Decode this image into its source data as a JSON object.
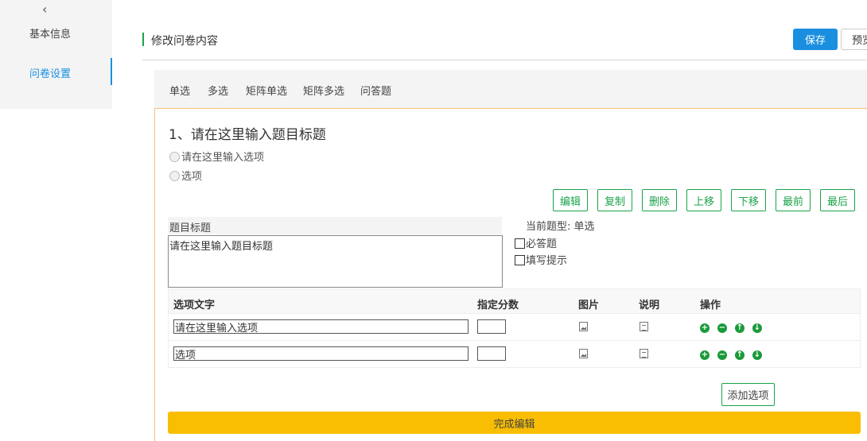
{
  "sidebar": {
    "back_icon": "chevron-left-icon",
    "items": [
      {
        "label": "基本信息"
      },
      {
        "label": "问卷设置"
      }
    ]
  },
  "header": {
    "title": "修改问卷内容",
    "save_label": "保存",
    "preview_label": "预览"
  },
  "question_types": [
    "单选",
    "多选",
    "矩阵单选",
    "矩阵多选",
    "问答题"
  ],
  "question": {
    "title": "1、请在这里输入题目标题",
    "options": [
      "请在这里输入选项",
      "选项"
    ],
    "actions": [
      "编辑",
      "复制",
      "删除",
      "上移",
      "下移",
      "最前",
      "最后"
    ],
    "title_label": "题目标题",
    "title_value": "请在这里输入题目标题",
    "current_type": "当前题型: 单选",
    "required_label": "必答题",
    "hint_label": "填写提示"
  },
  "table": {
    "headers": [
      "选项文字",
      "指定分数",
      "图片",
      "说明",
      "操作"
    ],
    "rows": [
      {
        "text": "请在这里输入选项",
        "score": ""
      },
      {
        "text": "选项",
        "score": ""
      }
    ]
  },
  "add_option_label": "添加选项",
  "done_label": "完成编辑",
  "colors": {
    "accent": "#1a8fe0",
    "green": "#1aa34a",
    "yellow": "#f9be02",
    "border_orange": "#f2c27b"
  }
}
